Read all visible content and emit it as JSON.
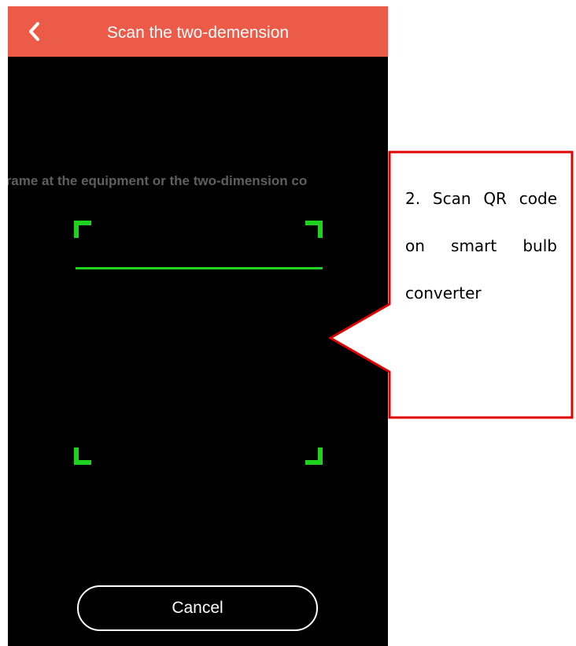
{
  "header": {
    "title": "Scan the two-demension",
    "back_icon": "chevron-left-icon"
  },
  "scanner": {
    "hint": "frame at the equipment or the two-dimension co",
    "frame_color": "#1fd21f"
  },
  "footer": {
    "cancel_label": "Cancel"
  },
  "callout": {
    "text": "2. Scan QR code on smart bulb converter",
    "border_color": "#e00000"
  },
  "colors": {
    "header_bg": "#ec5a48",
    "screen_bg": "#000000"
  }
}
